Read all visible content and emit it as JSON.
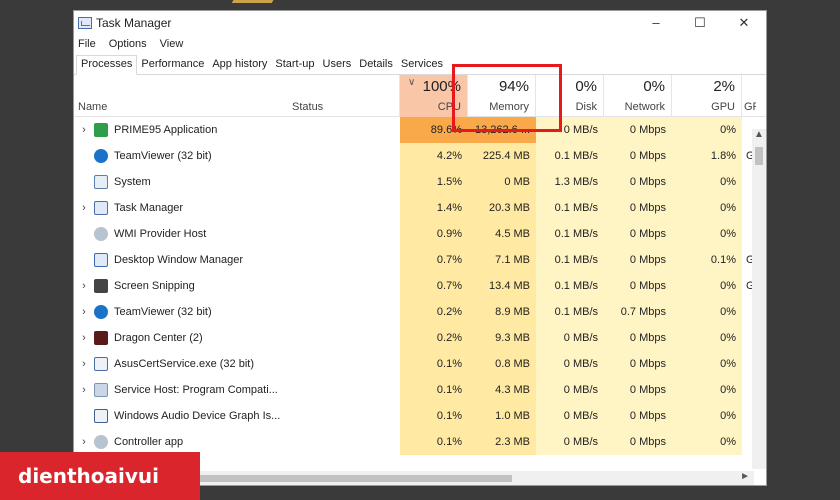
{
  "window": {
    "title": "Task Manager",
    "controls": {
      "minimize": "–",
      "maximize": "☐",
      "close": "✕"
    }
  },
  "menu": [
    "File",
    "Options",
    "View"
  ],
  "tabs": [
    "Processes",
    "Performance",
    "App history",
    "Start-up",
    "Users",
    "Details",
    "Services"
  ],
  "active_tab": "Processes",
  "columns": {
    "name": {
      "label": "Name"
    },
    "status": {
      "label": "Status"
    },
    "cpu": {
      "pct": "100%",
      "label": "CPU"
    },
    "memory": {
      "pct": "94%",
      "label": "Memory"
    },
    "disk": {
      "pct": "0%",
      "label": "Disk"
    },
    "network": {
      "pct": "0%",
      "label": "Network"
    },
    "gpu": {
      "pct": "2%",
      "label": "GPU"
    },
    "gpu_engine": {
      "label": "GPU"
    }
  },
  "processes": [
    {
      "expandable": true,
      "icon": "prime95-icon",
      "name": "PRIME95 Application",
      "status": "",
      "cpu": "89.6%",
      "memory": "13,262.6 ...",
      "disk": "0 MB/s",
      "network": "0 Mbps",
      "gpu": "0%",
      "gpu_engine": ""
    },
    {
      "expandable": false,
      "icon": "teamviewer-icon",
      "name": "TeamViewer (32 bit)",
      "status": "",
      "cpu": "4.2%",
      "memory": "225.4 MB",
      "disk": "0.1 MB/s",
      "network": "0 Mbps",
      "gpu": "1.8%",
      "gpu_engine": "G"
    },
    {
      "expandable": false,
      "icon": "system-icon",
      "name": "System",
      "status": "",
      "cpu": "1.5%",
      "memory": "0 MB",
      "disk": "1.3 MB/s",
      "network": "0 Mbps",
      "gpu": "0%",
      "gpu_engine": ""
    },
    {
      "expandable": true,
      "icon": "task-manager-icon",
      "name": "Task Manager",
      "status": "",
      "cpu": "1.4%",
      "memory": "20.3 MB",
      "disk": "0.1 MB/s",
      "network": "0 Mbps",
      "gpu": "0%",
      "gpu_engine": ""
    },
    {
      "expandable": false,
      "icon": "wmi-host-icon",
      "name": "WMI Provider Host",
      "status": "",
      "cpu": "0.9%",
      "memory": "4.5 MB",
      "disk": "0.1 MB/s",
      "network": "0 Mbps",
      "gpu": "0%",
      "gpu_engine": ""
    },
    {
      "expandable": false,
      "icon": "dwm-icon",
      "name": "Desktop Window Manager",
      "status": "",
      "cpu": "0.7%",
      "memory": "7.1 MB",
      "disk": "0.1 MB/s",
      "network": "0 Mbps",
      "gpu": "0.1%",
      "gpu_engine": "G"
    },
    {
      "expandable": true,
      "icon": "screen-snipping-icon",
      "name": "Screen Snipping",
      "status": "",
      "cpu": "0.7%",
      "memory": "13.4 MB",
      "disk": "0.1 MB/s",
      "network": "0 Mbps",
      "gpu": "0%",
      "gpu_engine": "G"
    },
    {
      "expandable": true,
      "icon": "teamviewer-icon",
      "name": "TeamViewer (32 bit)",
      "status": "",
      "cpu": "0.2%",
      "memory": "8.9 MB",
      "disk": "0.1 MB/s",
      "network": "0.7 Mbps",
      "gpu": "0%",
      "gpu_engine": ""
    },
    {
      "expandable": true,
      "icon": "dragon-center-icon",
      "name": "Dragon Center (2)",
      "status": "",
      "cpu": "0.2%",
      "memory": "9.3 MB",
      "disk": "0 MB/s",
      "network": "0 Mbps",
      "gpu": "0%",
      "gpu_engine": ""
    },
    {
      "expandable": true,
      "icon": "asus-service-icon",
      "name": "AsusCertService.exe (32 bit)",
      "status": "",
      "cpu": "0.1%",
      "memory": "0.8 MB",
      "disk": "0 MB/s",
      "network": "0 Mbps",
      "gpu": "0%",
      "gpu_engine": ""
    },
    {
      "expandable": true,
      "icon": "service-host-icon",
      "name": "Service Host: Program Compati...",
      "status": "",
      "cpu": "0.1%",
      "memory": "4.3 MB",
      "disk": "0 MB/s",
      "network": "0 Mbps",
      "gpu": "0%",
      "gpu_engine": ""
    },
    {
      "expandable": false,
      "icon": "audio-graph-icon",
      "name": "Windows Audio Device Graph Is...",
      "status": "",
      "cpu": "0.1%",
      "memory": "1.0 MB",
      "disk": "0 MB/s",
      "network": "0 Mbps",
      "gpu": "0%",
      "gpu_engine": ""
    },
    {
      "expandable": true,
      "icon": "controller-app-icon",
      "name": "Controller app",
      "status": "",
      "cpu": "0.1%",
      "memory": "2.3 MB",
      "disk": "0 MB/s",
      "network": "0 Mbps",
      "gpu": "0%",
      "gpu_engine": ""
    }
  ],
  "watermark": "dienthoaivui",
  "colors": {
    "highlight": "#e8191c",
    "cpu_hot": "#f9a84a",
    "heat_light": "#fff4c4",
    "heat_mid": "#ffe9a3",
    "watermark_bg": "#d9252b"
  }
}
